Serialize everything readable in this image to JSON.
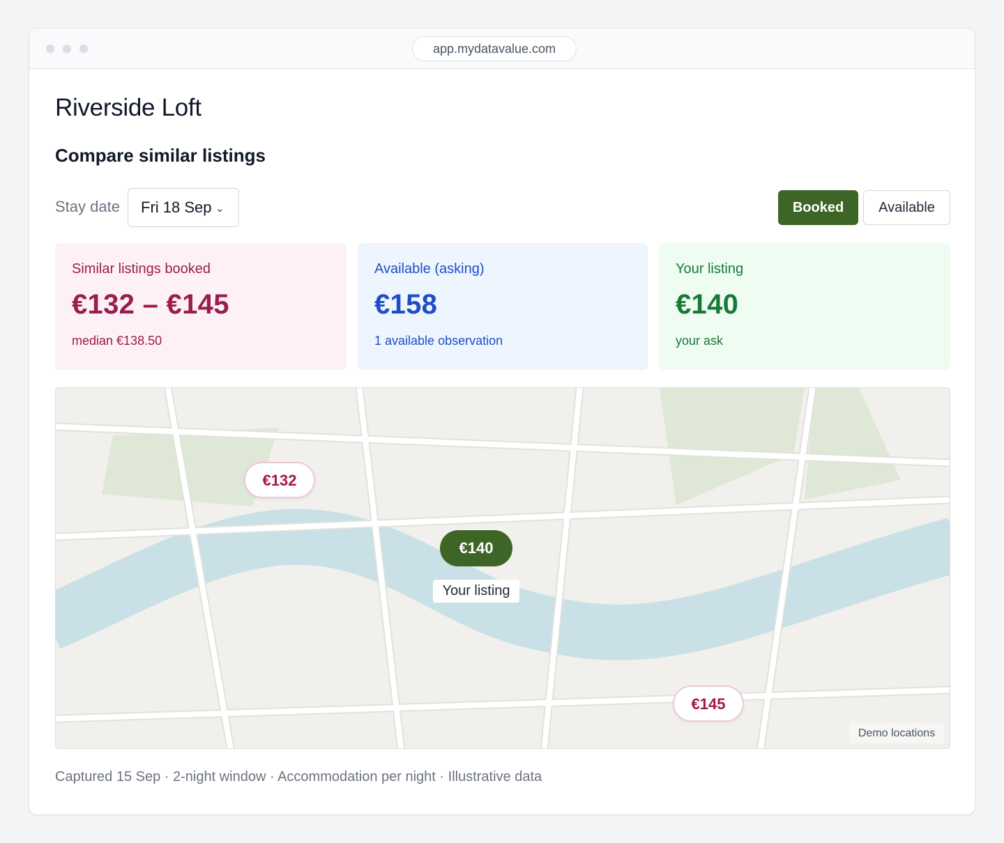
{
  "browser": {
    "url": "app.mydatavalue.com"
  },
  "page": {
    "title": "Riverside Loft",
    "section_title": "Compare similar listings"
  },
  "controls": {
    "stay_date_label": "Stay date",
    "stay_date_value": "Fri 18 Sep",
    "chevron_glyph": "⌄",
    "toggle": {
      "booked_label": "Booked",
      "available_label": "Available",
      "selected": "Booked"
    }
  },
  "cards": {
    "booked": {
      "label": "Similar listings booked",
      "value": "€132 – €145",
      "sub": "median €138.50",
      "color": "#9b1c4e"
    },
    "available": {
      "label": "Available (asking)",
      "value": "€158",
      "sub": "1 available observation",
      "color": "#1d4fc4"
    },
    "yours": {
      "label": "Your listing",
      "value": "€140",
      "sub": "your ask",
      "color": "#187a36"
    }
  },
  "map": {
    "pins": {
      "comp_1": "€132",
      "comp_2": "€145",
      "mine": "€140"
    },
    "your_listing_label": "Your listing",
    "demo_label": "Demo locations",
    "colors": {
      "land": "#f1f0ec",
      "park": "#dfe8d6",
      "water": "#c8e0e6",
      "road": "#ffffff",
      "mine_pin": "#3d6626",
      "comp_pin_text": "#a3174f"
    }
  },
  "footer": {
    "text": "Captured 15 Sep · 2-night window · Accommodation per night · Illustrative data"
  }
}
